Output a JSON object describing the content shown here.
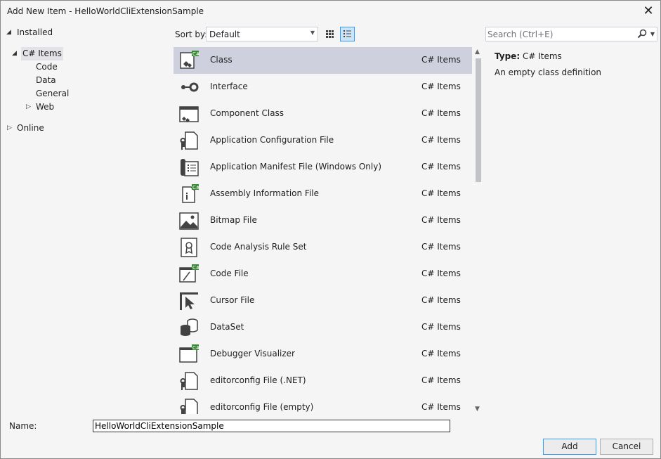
{
  "window": {
    "title": "Add New Item - HelloWorldCliExtensionSample",
    "close_glyph": "✕"
  },
  "tree": {
    "installed": "Installed",
    "csharp_items": "C# Items",
    "children": [
      "Code",
      "Data",
      "General",
      "Web"
    ],
    "online": "Online"
  },
  "sort": {
    "label": "Sort by:",
    "value": "Default"
  },
  "search": {
    "placeholder": "Search (Ctrl+E)"
  },
  "items": [
    {
      "name": "Class",
      "category": "C# Items",
      "icon": "class-icon"
    },
    {
      "name": "Interface",
      "category": "C# Items",
      "icon": "interface-icon"
    },
    {
      "name": "Component Class",
      "category": "C# Items",
      "icon": "component-class-icon"
    },
    {
      "name": "Application Configuration File",
      "category": "C# Items",
      "icon": "config-file-icon"
    },
    {
      "name": "Application Manifest File (Windows Only)",
      "category": "C# Items",
      "icon": "manifest-file-icon"
    },
    {
      "name": "Assembly Information File",
      "category": "C# Items",
      "icon": "assembly-info-icon"
    },
    {
      "name": "Bitmap File",
      "category": "C# Items",
      "icon": "bitmap-icon"
    },
    {
      "name": "Code Analysis Rule Set",
      "category": "C# Items",
      "icon": "rule-set-icon"
    },
    {
      "name": "Code File",
      "category": "C# Items",
      "icon": "code-file-icon"
    },
    {
      "name": "Cursor File",
      "category": "C# Items",
      "icon": "cursor-icon"
    },
    {
      "name": "DataSet",
      "category": "C# Items",
      "icon": "dataset-icon"
    },
    {
      "name": "Debugger Visualizer",
      "category": "C# Items",
      "icon": "debugger-visualizer-icon"
    },
    {
      "name": "editorconfig File (.NET)",
      "category": "C# Items",
      "icon": "editorconfig-icon"
    },
    {
      "name": "editorconfig File (empty)",
      "category": "C# Items",
      "icon": "editorconfig-icon"
    }
  ],
  "details": {
    "type_label": "Type:",
    "type_value": "C# Items",
    "description": "An empty class definition"
  },
  "bottom": {
    "name_label": "Name:",
    "name_value": "HelloWorldCliExtensionSample",
    "add_label": "Add",
    "cancel_label": "Cancel"
  }
}
